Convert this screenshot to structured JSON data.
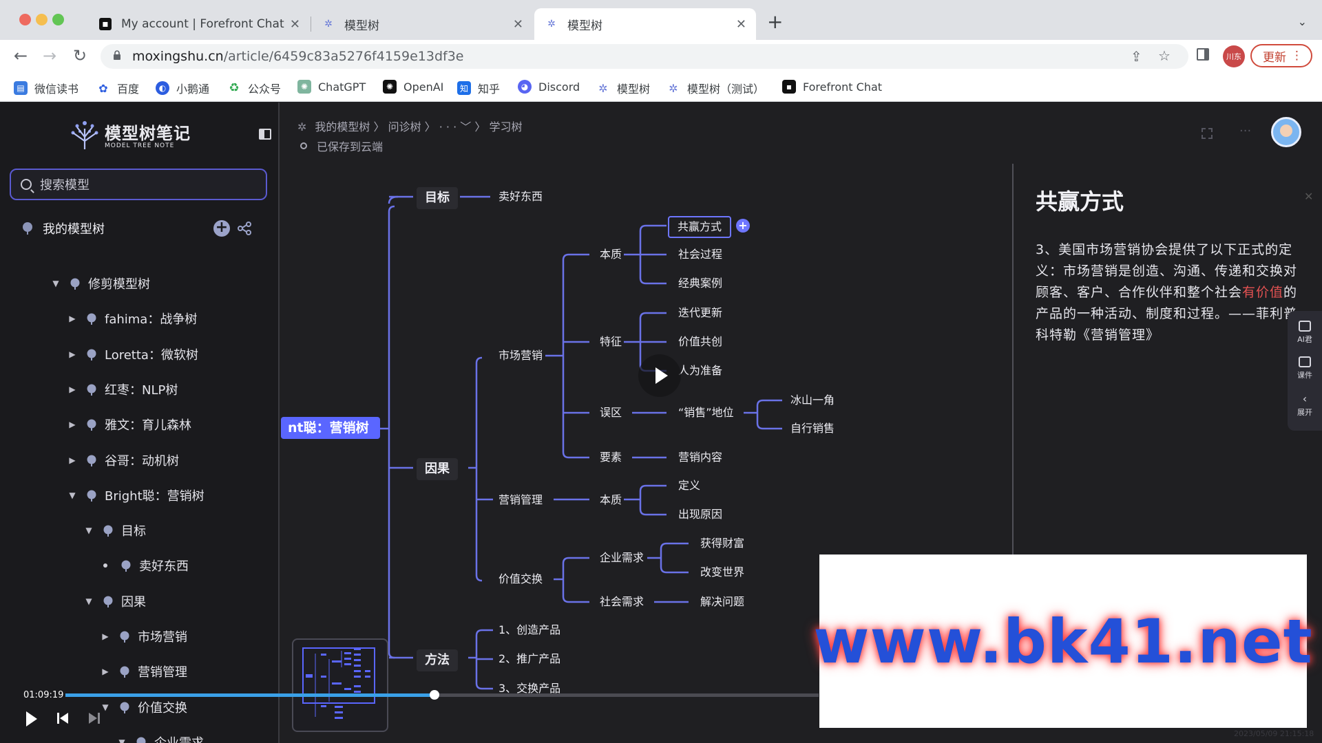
{
  "browser": {
    "tabs": [
      {
        "title": "My account | Forefront Chat",
        "active": false
      },
      {
        "title": "模型树",
        "active": false
      },
      {
        "title": "模型树",
        "active": true
      }
    ],
    "url_host": "moxingshu.cn",
    "url_path": "/article/6459c83a5276f4159e13df3e",
    "update_label": "更新",
    "profile_label": "川东",
    "bookmarks": [
      "微信读书",
      "百度",
      "小鹅通",
      "公众号",
      "ChatGPT",
      "OpenAI",
      "知乎",
      "Discord",
      "模型树",
      "模型树（测试）",
      "Forefront Chat"
    ]
  },
  "sidebar": {
    "logo_cn": "模型树笔记",
    "logo_en": "MODEL TREE NOTE",
    "search_placeholder": "搜索模型",
    "header": "我的模型树",
    "items": [
      {
        "label": "修剪模型树",
        "level": 1,
        "caret": "▼"
      },
      {
        "label": "fahima：战争树",
        "level": 2,
        "caret": "▶"
      },
      {
        "label": "Loretta：微软树",
        "level": 2,
        "caret": "▶"
      },
      {
        "label": "红枣：NLP树",
        "level": 2,
        "caret": "▶"
      },
      {
        "label": "雅文：育儿森林",
        "level": 2,
        "caret": "▶"
      },
      {
        "label": "谷哥：动机树",
        "level": 2,
        "caret": "▶"
      },
      {
        "label": "Bright聪：营销树",
        "level": 2,
        "caret": "▼"
      },
      {
        "label": "目标",
        "level": 3,
        "caret": "▼"
      },
      {
        "label": "卖好东西",
        "level": 4,
        "caret": "•"
      },
      {
        "label": "因果",
        "level": 3,
        "caret": "▼"
      },
      {
        "label": "市场营销",
        "level": 4,
        "caret": "▶"
      },
      {
        "label": "营销管理",
        "level": 4,
        "caret": "▶"
      },
      {
        "label": "价值交换",
        "level": 4,
        "caret": "▼"
      },
      {
        "label": "企业需求",
        "level": 5,
        "caret": "▼"
      }
    ]
  },
  "canvas": {
    "breadcrumb": "我的模型树 〉 问诊树 〉 · · ·  ﹀ 〉 学习树",
    "saved_status": "已保存到云端",
    "root": "nt聪：营销树",
    "nodes": {
      "goal": "目标",
      "goal_child": "卖好东西",
      "cause": "因果",
      "method": "方法",
      "marketing": "市场营销",
      "mgmt": "营销管理",
      "value_ex": "价值交换",
      "essence": "本质",
      "feature": "特征",
      "myth": "误区",
      "element": "要素",
      "winwin": "共赢方式",
      "social_proc": "社会过程",
      "classic": "经典案例",
      "iterate": "迭代更新",
      "cocreate": "价值共创",
      "prep": "人为准备",
      "sales_pos": "“销售”地位",
      "iceberg": "冰山一角",
      "selfsell": "自行销售",
      "content": "营销内容",
      "essence2": "本质",
      "definition": "定义",
      "reason": "出现原因",
      "biz_need": "企业需求",
      "wealth": "获得财富",
      "change": "改变世界",
      "soc_need": "社会需求",
      "solve": "解决问题",
      "m1": "1、创造产品",
      "m2": "2、推广产品",
      "m3": "3、交换产品"
    }
  },
  "panel": {
    "title": "共赢方式",
    "body_before": "3、美国市场营销协会提供了以下正式的定义：市场营销是创造、沟通、传递和交换对顾客、客户、合作伙伴和整个社会",
    "body_highlight": "有价值",
    "body_after": "的产品的一种活动、制度和过程。——菲利普·科特勒《营销管理》",
    "tools": [
      "AI君",
      "课件",
      "展开"
    ]
  },
  "video": {
    "timestamp": "01:09:19",
    "progress": 0.49
  },
  "watermark": "www.bk41.net",
  "date_watermark": "2023/05/09 21:15:18"
}
